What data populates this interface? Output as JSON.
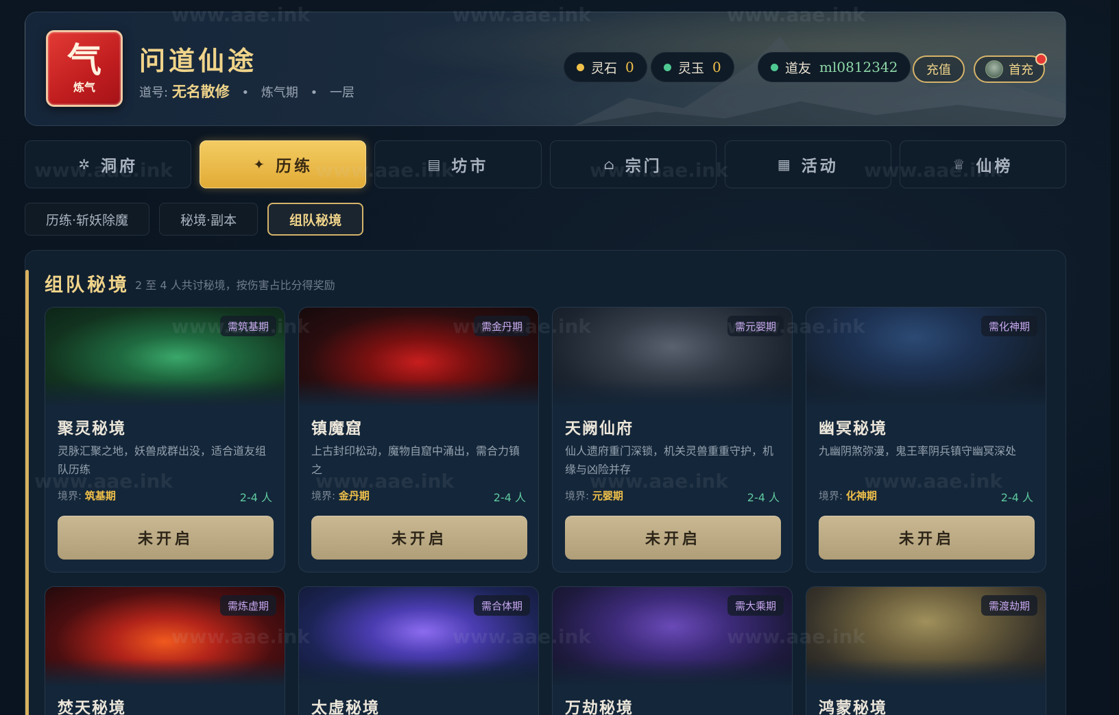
{
  "header": {
    "logo_char": "气",
    "logo_sub": "炼气",
    "title": "问道仙途",
    "dao_label": "道号:",
    "dao_name": "无名散修",
    "stage": "炼气期",
    "layer": "一层",
    "lingshi_label": "灵石",
    "lingshi_value": "0",
    "lingyu_label": "灵玉",
    "lingyu_value": "0",
    "user_label": "道友",
    "user_name": "ml0812342",
    "recharge_label": "充值",
    "first_recharge_label": "首充"
  },
  "tabs": [
    {
      "label": "洞府",
      "icon": "sparkle-icon"
    },
    {
      "label": "历练",
      "icon": "star-icon"
    },
    {
      "label": "坊市",
      "icon": "shop-icon"
    },
    {
      "label": "宗门",
      "icon": "home-icon"
    },
    {
      "label": "活动",
      "icon": "document-icon"
    },
    {
      "label": "仙榜",
      "icon": "trophy-icon"
    }
  ],
  "subtabs": [
    "历练·斩妖除魔",
    "秘境·副本",
    "组队秘境"
  ],
  "panel": {
    "title": "组队秘境",
    "desc": "2 至 4 人共讨秘境，按伤害占比分得奖励"
  },
  "realm_label": "境界:",
  "cards": [
    {
      "tag": "需筑基期",
      "name": "聚灵秘境",
      "desc": "灵脉汇聚之地，妖兽成群出没，适合道友组队历练",
      "realm": "筑基期",
      "size": "2-4 人",
      "btn": "未开启"
    },
    {
      "tag": "需金丹期",
      "name": "镇魔窟",
      "desc": "上古封印松动，魔物自窟中涌出，需合力镇之",
      "realm": "金丹期",
      "size": "2-4 人",
      "btn": "未开启"
    },
    {
      "tag": "需元婴期",
      "name": "天阙仙府",
      "desc": "仙人遗府重门深锁，机关灵兽重重守护，机缘与凶险并存",
      "realm": "元婴期",
      "size": "2-4 人",
      "btn": "未开启"
    },
    {
      "tag": "需化神期",
      "name": "幽冥秘境",
      "desc": "九幽阴煞弥漫，鬼王率阴兵镇守幽冥深处",
      "realm": "化神期",
      "size": "2-4 人",
      "btn": "未开启"
    },
    {
      "tag": "需炼虚期",
      "name": "焚天秘境"
    },
    {
      "tag": "需合体期",
      "name": "太虚秘境"
    },
    {
      "tag": "需大乘期",
      "name": "万劫秘境"
    },
    {
      "tag": "需渡劫期",
      "name": "鸿蒙秘境"
    }
  ],
  "colors": {
    "accent_gold": "#f0d48a",
    "active_tab": "#e8b84a",
    "bg": "#0a1420",
    "realm_color": "#f0c04a",
    "party_size_color": "#5fc9a0"
  },
  "watermark": "www.aae.ink"
}
